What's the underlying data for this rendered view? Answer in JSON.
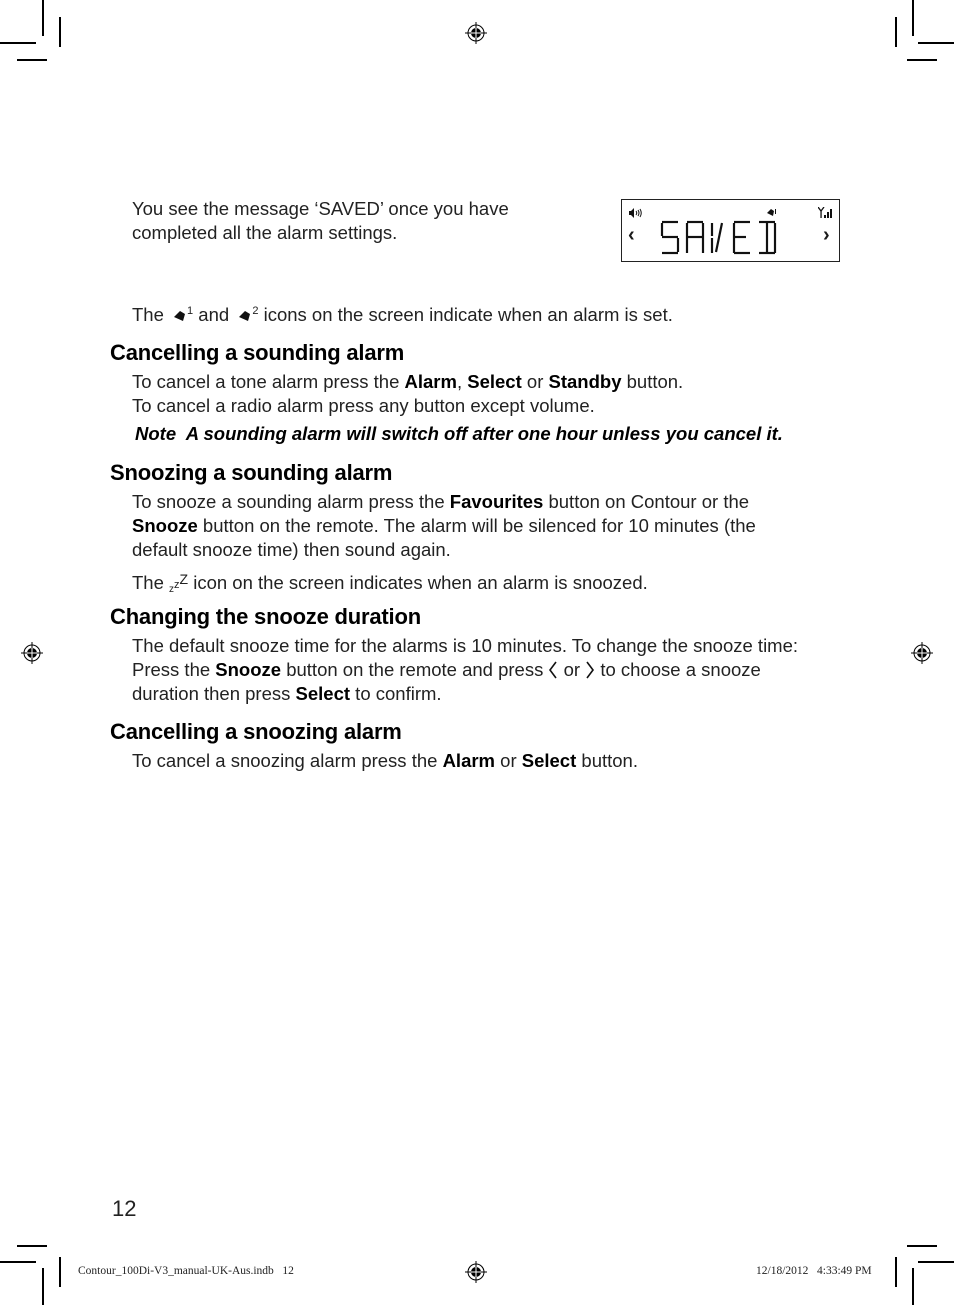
{
  "page": {
    "number": "12"
  },
  "intro": {
    "saved_message": "You see the message ‘SAVED’ once you have completed all the alarm settings.",
    "saved_message_line1": "You see the message ‘SAVED’ once you have",
    "saved_message_line2": "completed all the alarm settings.",
    "icons_sentence_prefix": "The",
    "icons_sentence_and": "and",
    "icons_sentence_suffix": "icons on the screen indicate when an alarm is set.",
    "alarm_icon_1_label": "1",
    "alarm_icon_2_label": "2"
  },
  "lcd_display": {
    "text": "SAVED",
    "left_arrow": "‹",
    "right_arrow": "›",
    "icons": [
      "volume-icon",
      "alarm-bell-1-icon",
      "signal-strength-icon"
    ]
  },
  "sections": [
    {
      "heading": "Cancelling a sounding alarm",
      "p1": {
        "t1": "To cancel a tone alarm press the ",
        "b1": "Alarm",
        "t2": ", ",
        "b2": "Select",
        "t3": " or ",
        "b3": "Standby",
        "t4": " button."
      },
      "p2": "To cancel a radio alarm press any button except volume.",
      "note": "Note  A sounding alarm will switch off after one hour unless you cancel it."
    },
    {
      "heading": "Snoozing a sounding alarm",
      "p1": {
        "t1": "To snooze a sounding alarm press the ",
        "b1": "Favourites",
        "t2": " button on Contour or the",
        "b2": "Snooze",
        "t3": " button on the remote. The alarm will be silenced for 10 minutes (the",
        "t4": "default snooze time) then sound again."
      },
      "p2": {
        "t1": "The ",
        "icon": "zZ",
        "t2": " icon on the screen indicates when an alarm is snoozed."
      }
    },
    {
      "heading": "Changing the snooze duration",
      "p1": "The default snooze time for the alarms is 10 minutes. To change the snooze time:",
      "p2": {
        "t1": "Press the ",
        "b1": "Snooze",
        "t2": " button on the remote and press ",
        "left": "〈",
        "t3": " or ",
        "right": "〉",
        "t4": " to choose a snooze"
      },
      "p3": {
        "t1": "duration then press ",
        "b1": "Select",
        "t2": " to confirm."
      }
    },
    {
      "heading": "Cancelling a snoozing alarm",
      "p1": {
        "t1": "To cancel a snoozing alarm press the ",
        "b1": "Alarm",
        "t2": " or ",
        "b2": "Select",
        "t3": " button."
      }
    }
  ],
  "print_slug": {
    "file": "Contour_100Di-V3_manual-UK-Aus.indb   12",
    "timestamp": "12/18/2012   4:33:49 PM"
  }
}
